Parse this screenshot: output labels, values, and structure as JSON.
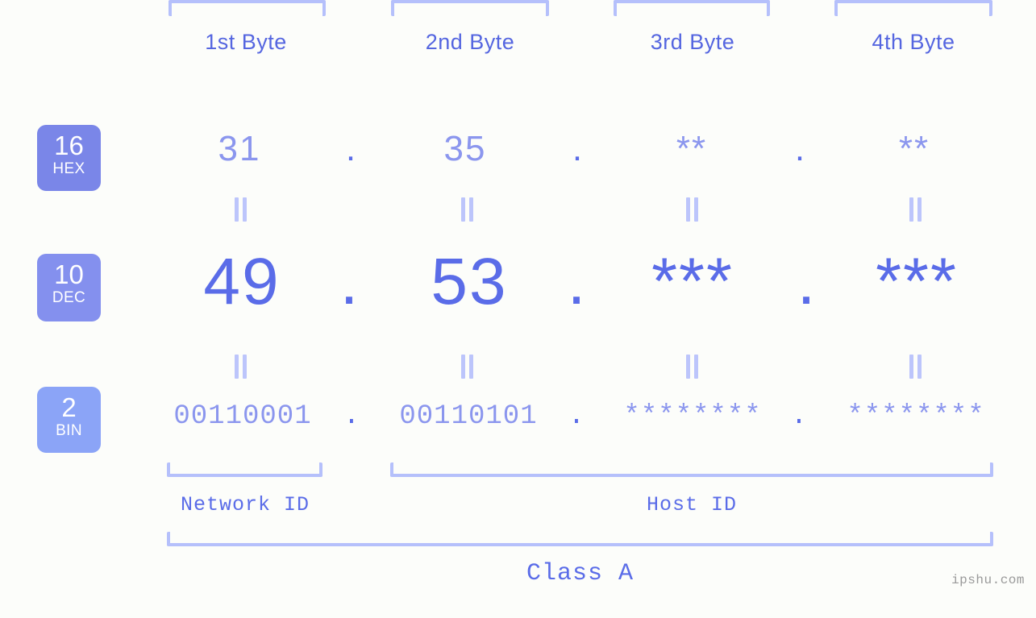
{
  "colors": {
    "background": "#fcfdfa",
    "accent_strong": "#5a6ce8",
    "accent_mid": "#8b96ee",
    "accent_light": "#b5c0fb",
    "badge_hex": "#7a86e8",
    "badge_dec": "#8490ee",
    "badge_bin": "#8ba4f7",
    "label_blue": "#5566e0",
    "watermark_gray": "#9a9a9a"
  },
  "byte_headers": [
    {
      "label": "1st Byte"
    },
    {
      "label": "2nd Byte"
    },
    {
      "label": "3rd Byte"
    },
    {
      "label": "4th Byte"
    }
  ],
  "radix_badges": [
    {
      "number": "16",
      "name": "HEX"
    },
    {
      "number": "10",
      "name": "DEC"
    },
    {
      "number": "2",
      "name": "BIN"
    }
  ],
  "rows": {
    "hex": {
      "radix": "16",
      "radix_name": "HEX",
      "values": [
        "31",
        "35",
        "**",
        "**"
      ],
      "separator": "."
    },
    "dec": {
      "radix": "10",
      "radix_name": "DEC",
      "values": [
        "49",
        "53",
        "***",
        "***"
      ],
      "separator": "."
    },
    "bin": {
      "radix": "2",
      "radix_name": "BIN",
      "values": [
        "00110001",
        "00110101",
        "********",
        "********"
      ],
      "separator": "."
    }
  },
  "equivalence_marks": {
    "glyph": "||",
    "count_per_gap": 4,
    "gaps": 2
  },
  "footer": {
    "network_id_label": "Network ID",
    "host_id_label": "Host ID",
    "class_label": "Class A"
  },
  "watermark": {
    "text": "ipshu.com"
  }
}
